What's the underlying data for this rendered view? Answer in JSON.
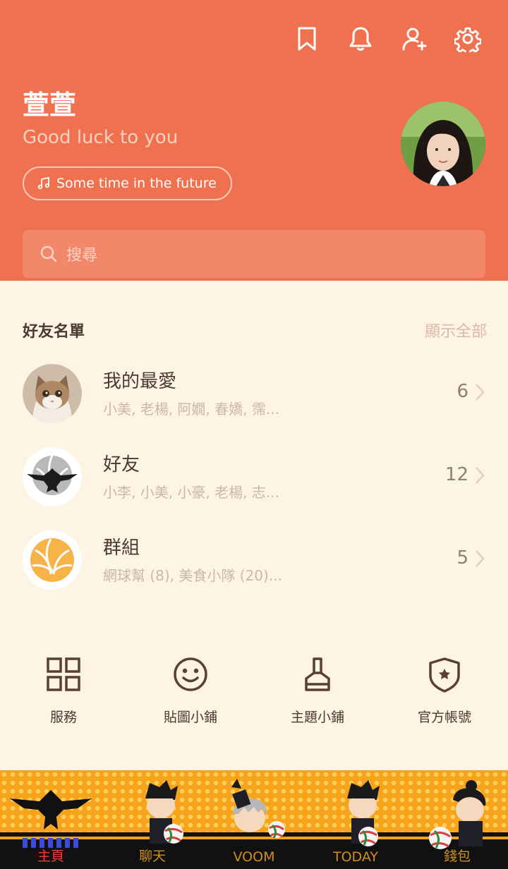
{
  "colors": {
    "header_bg": "#f0714f",
    "body_bg": "#fdf4e3",
    "accent_active": "#ff3b2b"
  },
  "header": {
    "icons": [
      "bookmark-icon",
      "bell-icon",
      "add-friend-icon",
      "gear-icon"
    ],
    "profile_name": "萱萱",
    "status_message": "Good luck to you",
    "music": "Some time in the future",
    "search_placeholder": "搜尋"
  },
  "friends": {
    "title": "好友名單",
    "show_all": "顯示全部",
    "rows": [
      {
        "title": "我的最愛",
        "members": "小美, 老楊, 阿嫺, 春嬌, 霈...",
        "count": "6"
      },
      {
        "title": "好友",
        "members": "小李, 小美, 小豪, 老楊, 志...",
        "count": "12"
      },
      {
        "title": "群組",
        "members": "網球幫 (8), 美食小隊 (20)...",
        "count": "5"
      }
    ]
  },
  "services": [
    {
      "label": "服務",
      "icon": "grid-icon"
    },
    {
      "label": "貼圖小鋪",
      "icon": "smiley-icon"
    },
    {
      "label": "主題小鋪",
      "icon": "brush-icon"
    },
    {
      "label": "官方帳號",
      "icon": "shield-star-icon"
    }
  ],
  "bottom_nav": [
    {
      "label": "主頁",
      "active": true
    },
    {
      "label": "聊天",
      "active": false
    },
    {
      "label": "VOOM",
      "active": false
    },
    {
      "label": "TODAY",
      "active": false
    },
    {
      "label": "錢包",
      "active": false
    }
  ]
}
